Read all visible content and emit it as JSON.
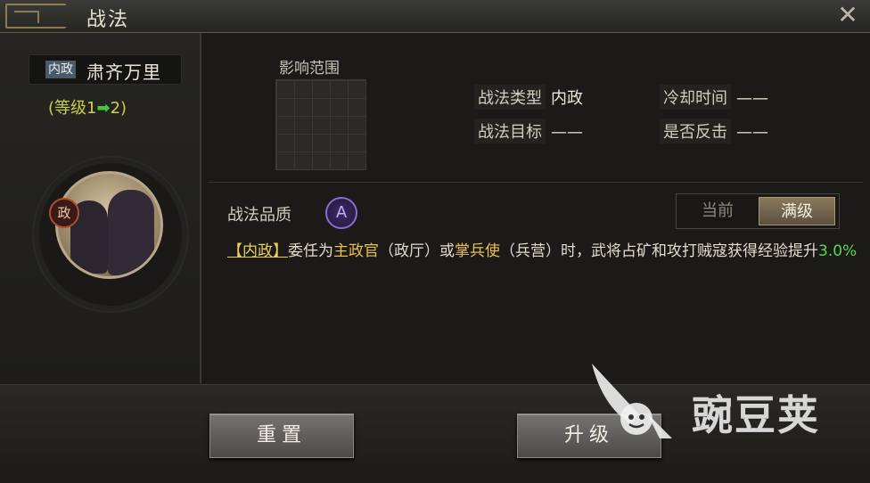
{
  "window": {
    "title": "战法"
  },
  "skill": {
    "type_tag": "内政",
    "name": "肃齐万里",
    "level_open": "(等级1",
    "level_arrow": "➡",
    "level_close": "2)",
    "badge": "政"
  },
  "range": {
    "label": "影响范围"
  },
  "stats": {
    "type_label": "战法类型",
    "type_value": "内政",
    "cooldown_label": "冷却时间",
    "cooldown_value": "——",
    "target_label": "战法目标",
    "target_value": "——",
    "counter_label": "是否反击",
    "counter_value": "——"
  },
  "quality": {
    "label": "战法品质",
    "grade": "A"
  },
  "toggle": {
    "current": "当前",
    "max": "满级",
    "selected": "满级"
  },
  "description": {
    "tag": "【内政】",
    "part1": "委任为",
    "role1": "主政官",
    "part2": "（政厅）或",
    "role2": "掌兵使",
    "part3": "（兵营）时，武将占矿和攻打贼寇获得经验提升",
    "value": "3.0%"
  },
  "buttons": {
    "reset": "重置",
    "upgrade": "升级"
  },
  "watermark": {
    "text": "豌豆荚"
  },
  "colors": {
    "gold": "#e8c04a",
    "green": "#58d84a",
    "purple": "#8a6cd0"
  }
}
